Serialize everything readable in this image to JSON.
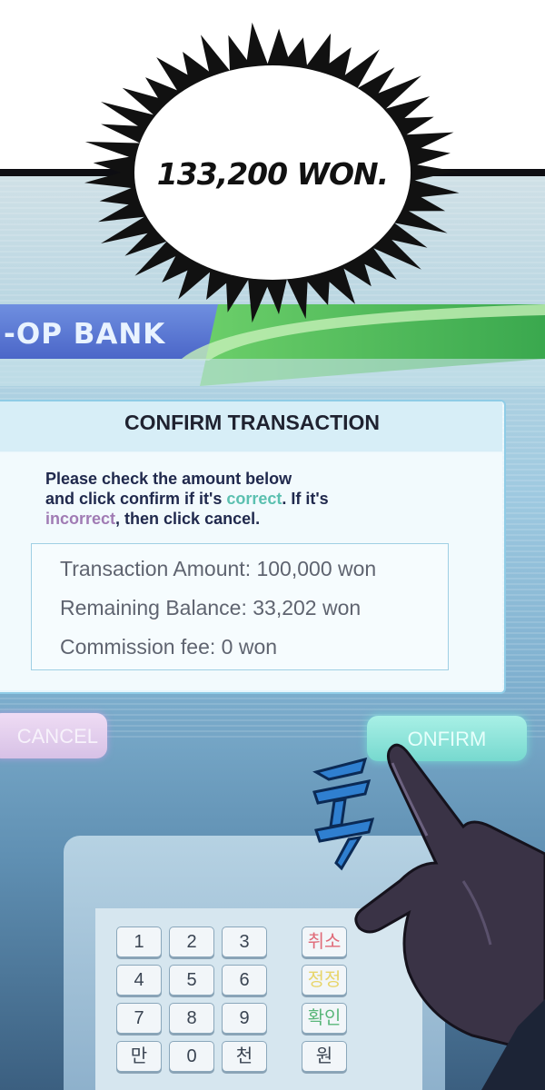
{
  "speech_bubble": {
    "text": "133,200 WON."
  },
  "bank": {
    "name": "-OP BANK"
  },
  "dialog": {
    "title": "CONFIRM TRANSACTION",
    "instruction": {
      "line1": "Please check the amount below",
      "line2_prefix": "and click confirm if it's ",
      "correct_word": "correct",
      "line2_suffix": ". If it's",
      "incorrect_word": "incorrect",
      "line3_suffix": ", then click cancel."
    },
    "info": {
      "transaction_amount": "Transaction Amount: 100,000 won",
      "remaining_balance": "Remaining Balance: 33,202 won",
      "commission_fee": "Commission fee: 0 won"
    }
  },
  "buttons": {
    "cancel_label": "CANCEL",
    "confirm_label": "ONFIRM"
  },
  "keypad": {
    "rows": [
      [
        "1",
        "2",
        "3",
        "취소"
      ],
      [
        "4",
        "5",
        "6",
        "정정"
      ],
      [
        "7",
        "8",
        "9",
        "확인"
      ],
      [
        "만",
        "0",
        "천",
        "원"
      ]
    ]
  },
  "colors": {
    "accent_correct": "#5bc0b0",
    "accent_incorrect": "#a07bb4",
    "confirm_button": "#77d9cf",
    "cancel_button": "#d7c1e6"
  },
  "icons": {
    "hand": "pointing-hand-icon",
    "sound_effect": "tok-sfx-icon"
  }
}
